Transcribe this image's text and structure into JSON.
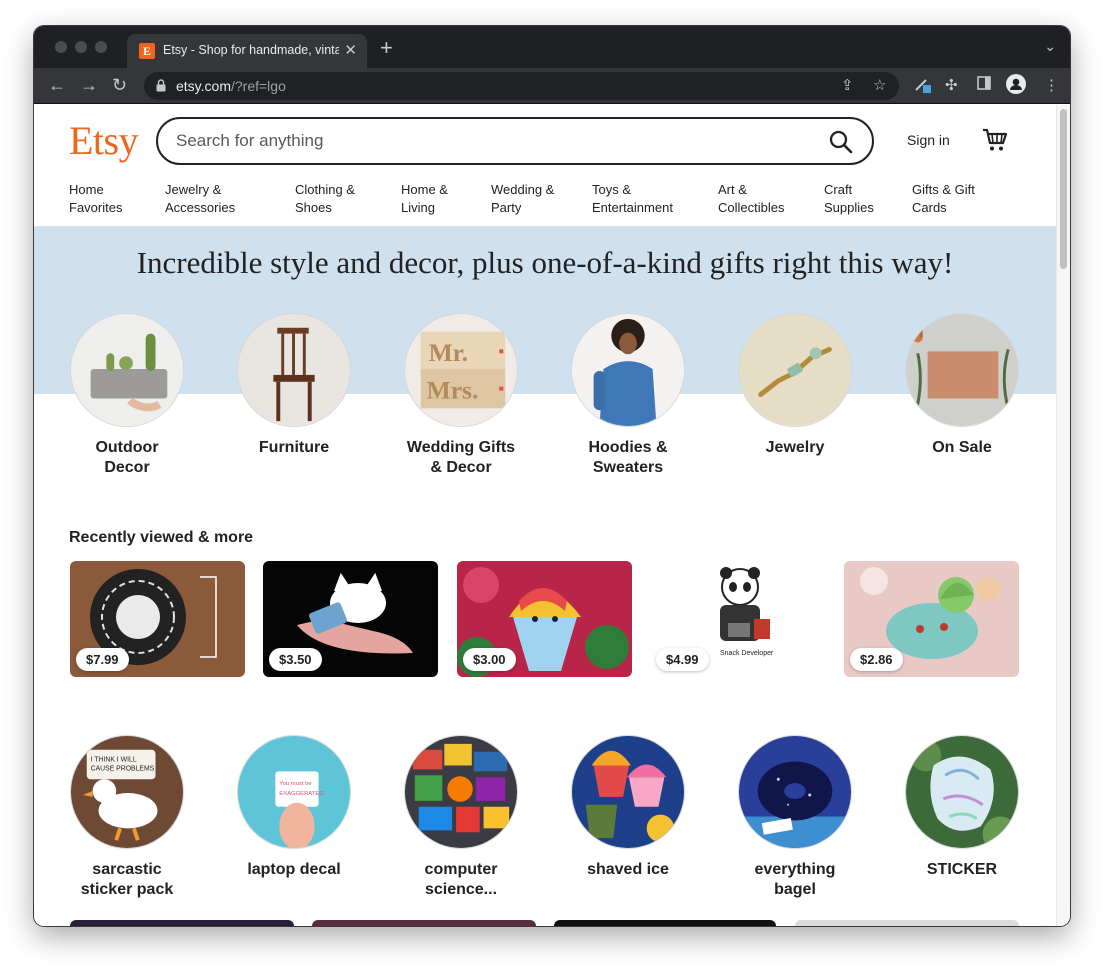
{
  "browser": {
    "tab_title": "Etsy - Shop for handmade, vintage, custom, and unique gifts",
    "favicon_letter": "E",
    "url_host": "etsy.com",
    "url_path": "/?ref=lgo",
    "new_tab": "+",
    "close": "✕"
  },
  "header": {
    "logo": "Etsy",
    "search_placeholder": "Search for anything",
    "sign_in": "Sign in"
  },
  "categories": [
    {
      "line1": "Home",
      "line2": "Favorites"
    },
    {
      "line1": "Jewelry &",
      "line2": "Accessories"
    },
    {
      "line1": "Clothing &",
      "line2": "Shoes"
    },
    {
      "line1": "Home &",
      "line2": "Living"
    },
    {
      "line1": "Wedding &",
      "line2": "Party"
    },
    {
      "line1": "Toys &",
      "line2": "Entertainment"
    },
    {
      "line1": "Art &",
      "line2": "Collectibles"
    },
    {
      "line1": "Craft",
      "line2": "Supplies"
    },
    {
      "line1": "Gifts & Gift",
      "line2": "Cards"
    }
  ],
  "hero": {
    "title": "Incredible style and decor, plus one-of-a-kind gifts right this way!",
    "circles": [
      {
        "line1": "Outdoor",
        "line2": "Decor"
      },
      {
        "line1": "Furniture",
        "line2": ""
      },
      {
        "line1": "Wedding Gifts",
        "line2": "& Decor"
      },
      {
        "line1": "Hoodies &",
        "line2": "Sweaters"
      },
      {
        "line1": "Jewelry",
        "line2": ""
      },
      {
        "line1": "On Sale",
        "line2": ""
      }
    ]
  },
  "recent": {
    "title": "Recently viewed & more",
    "items": [
      {
        "price": "$7.99"
      },
      {
        "price": "$3.50"
      },
      {
        "price": "$3.00"
      },
      {
        "price": "$4.99"
      },
      {
        "price": "$2.86"
      }
    ]
  },
  "searches": [
    {
      "line1": "sarcastic",
      "line2": "sticker pack"
    },
    {
      "line1": "laptop decal",
      "line2": ""
    },
    {
      "line1": "computer",
      "line2": "science..."
    },
    {
      "line1": "shaved ice",
      "line2": ""
    },
    {
      "line1": "everything",
      "line2": "bagel"
    },
    {
      "line1": "STICKER",
      "line2": ""
    }
  ],
  "colors": {
    "brand": "#f1641e",
    "hero_bg": "#cfe0ee"
  }
}
